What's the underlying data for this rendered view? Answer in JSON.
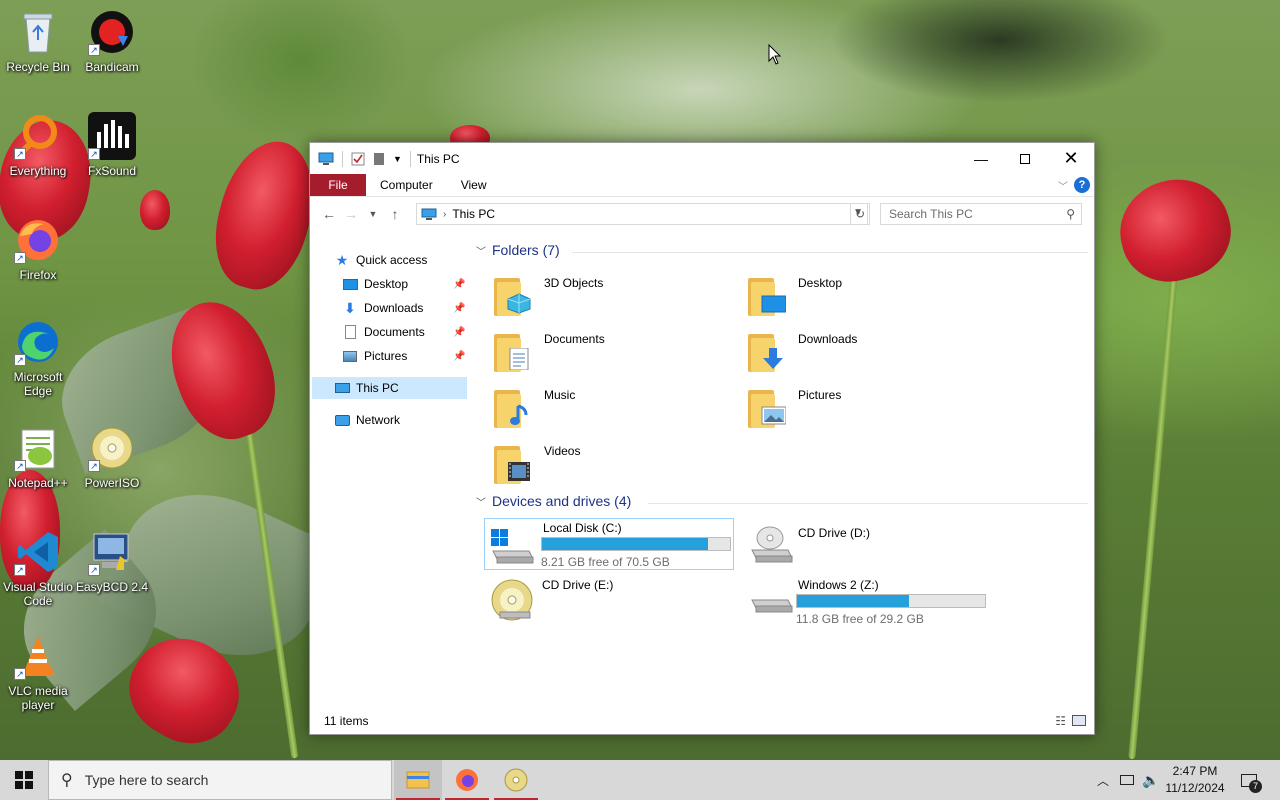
{
  "desktop": {
    "icons": [
      {
        "label": "Recycle Bin"
      },
      {
        "label": "Bandicam"
      },
      {
        "label": "Everything"
      },
      {
        "label": "FxSound"
      },
      {
        "label": "Firefox"
      },
      {
        "label": "Microsoft Edge"
      },
      {
        "label": "Notepad++"
      },
      {
        "label": "PowerISO"
      },
      {
        "label": "Visual Studio Code"
      },
      {
        "label": "EasyBCD 2.4"
      },
      {
        "label": "VLC media player"
      }
    ]
  },
  "window": {
    "title": "This PC",
    "ribbon_tabs": [
      "File",
      "Computer",
      "View"
    ],
    "help_label": "?",
    "address": "This PC",
    "search_placeholder": "Search This PC",
    "nav": {
      "quick_access": "Quick access",
      "items": [
        "Desktop",
        "Downloads",
        "Documents",
        "Pictures"
      ],
      "this_pc": "This PC",
      "network": "Network"
    },
    "folders_header": "Folders (7)",
    "folders": [
      "3D Objects",
      "Desktop",
      "Documents",
      "Downloads",
      "Music",
      "Pictures",
      "Videos"
    ],
    "devices_header": "Devices and drives (4)",
    "drives": [
      {
        "name": "Local Disk (C:)",
        "free": "8.21 GB free of 70.5 GB",
        "used_fraction": 0.884
      },
      {
        "name": "CD Drive (D:)"
      },
      {
        "name": "CD Drive (E:)"
      },
      {
        "name": "Windows 2 (Z:)",
        "free": "11.8 GB free of 29.2 GB",
        "used_fraction": 0.596
      }
    ],
    "status": "11 items"
  },
  "taskbar": {
    "search_placeholder": "Type here to search",
    "time": "2:47 PM",
    "date": "11/12/2024",
    "notification_count": "7"
  },
  "colors": {
    "accent": "#26a0da",
    "file_tab": "#a51d2d",
    "header_blue": "#1e3287"
  }
}
